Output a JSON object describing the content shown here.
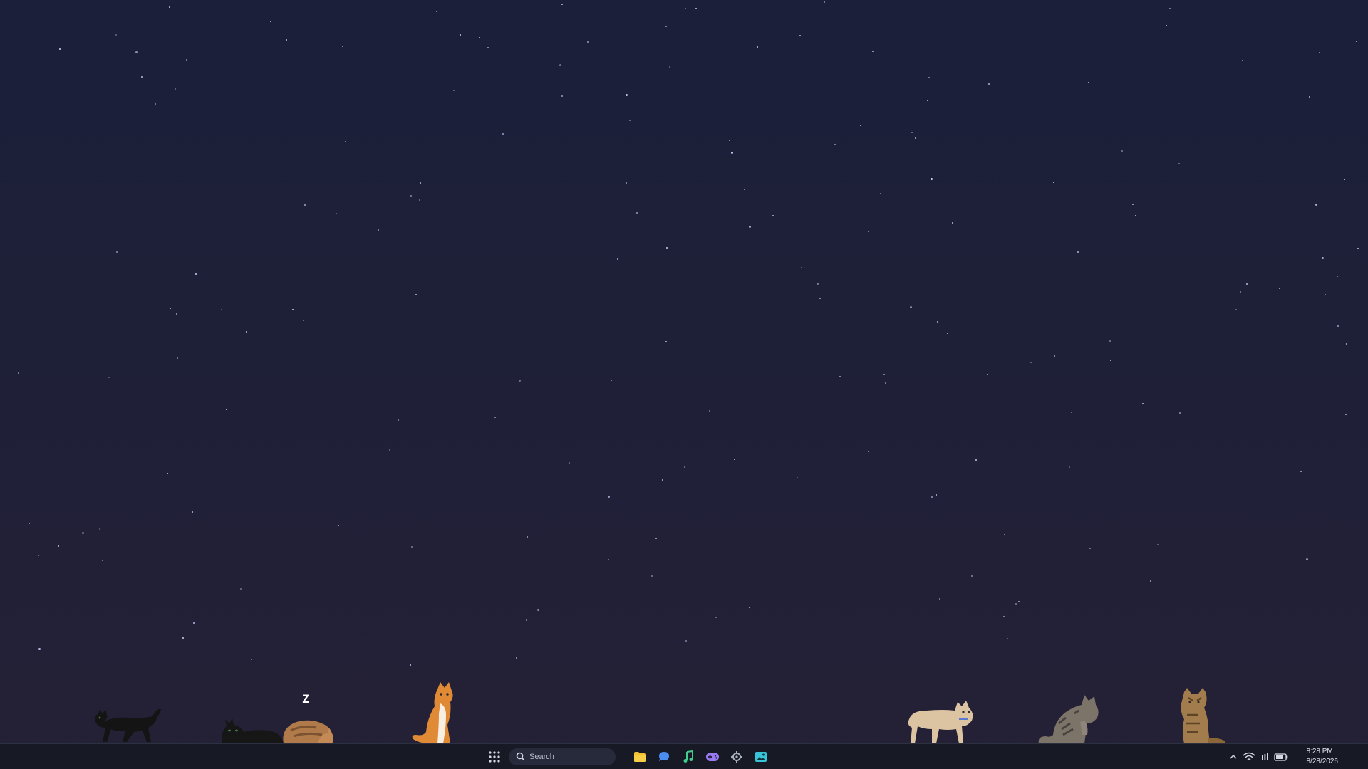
{
  "desktop": {
    "wallpaper": "night-sky-stars",
    "colors": {
      "sky_top": "#1b1f39",
      "sky_bottom": "#252136",
      "taskbar": "#171a25"
    },
    "cats": [
      {
        "name": "black-cat-walking",
        "fur": "#141414"
      },
      {
        "name": "black-cat-lying",
        "fur": "#161616"
      },
      {
        "name": "brown-cat-sleeping",
        "fur": "#b07a4a",
        "zzz": "Z"
      },
      {
        "name": "orange-cat-sitting",
        "fur": "#e08a36"
      },
      {
        "name": "cream-cat-walking",
        "fur": "#dcc3a2"
      },
      {
        "name": "tabby-cat-grooming",
        "fur": "#7c7468"
      },
      {
        "name": "brown-tabby-cat-sitting",
        "fur": "#a27c4c"
      }
    ]
  },
  "taskbar": {
    "launcher_icon": "app-grid-icon",
    "search": {
      "placeholder": "Search",
      "icon": "search-icon"
    },
    "apps": [
      {
        "name": "files",
        "icon": "folder-icon",
        "color": "#f5c12e"
      },
      {
        "name": "messages",
        "icon": "chat-icon",
        "color": "#4a8cf0"
      },
      {
        "name": "music",
        "icon": "music-note-icon",
        "color": "#3fcf8e"
      },
      {
        "name": "games",
        "icon": "gamepad-icon",
        "color": "#9a7af0"
      },
      {
        "name": "settings",
        "icon": "gear-icon",
        "color": "#aab0c0"
      },
      {
        "name": "photos",
        "icon": "image-icon",
        "color": "#38c4d8"
      }
    ],
    "tray": {
      "icons": [
        "chevron-up-icon",
        "wifi-icon",
        "volume-icon",
        "battery-icon"
      ],
      "time": "8:28 PM",
      "date": "8/28/2026"
    }
  }
}
